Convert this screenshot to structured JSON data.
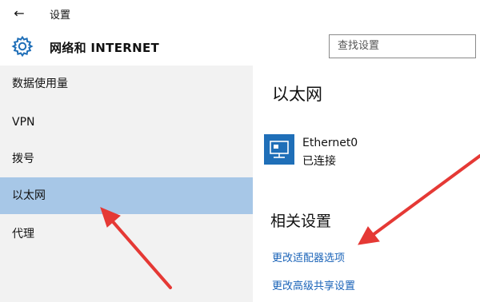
{
  "window": {
    "back_glyph": "←",
    "title": "设置"
  },
  "header": {
    "gear_icon": "gear-icon",
    "title": "网络和 INTERNET",
    "search_placeholder": "查找设置"
  },
  "sidebar": {
    "items": [
      {
        "label": "数据使用量"
      },
      {
        "label": "VPN"
      },
      {
        "label": "拨号"
      },
      {
        "label": "以太网"
      },
      {
        "label": "代理"
      }
    ]
  },
  "main": {
    "heading": "以太网",
    "adapter": {
      "icon": "ethernet-icon",
      "name": "Ethernet0",
      "status": "已连接"
    },
    "related_heading": "相关设置",
    "links": [
      {
        "label": "更改适配器选项"
      },
      {
        "label": "更改高级共享设置"
      }
    ]
  },
  "colors": {
    "accent": "#1a63b8",
    "selected_nav": "#a7c7e7",
    "sidebar_bg": "#f2f2f2",
    "icon_bg": "#1f6fb8",
    "annotation_arrow": "#e53935"
  }
}
